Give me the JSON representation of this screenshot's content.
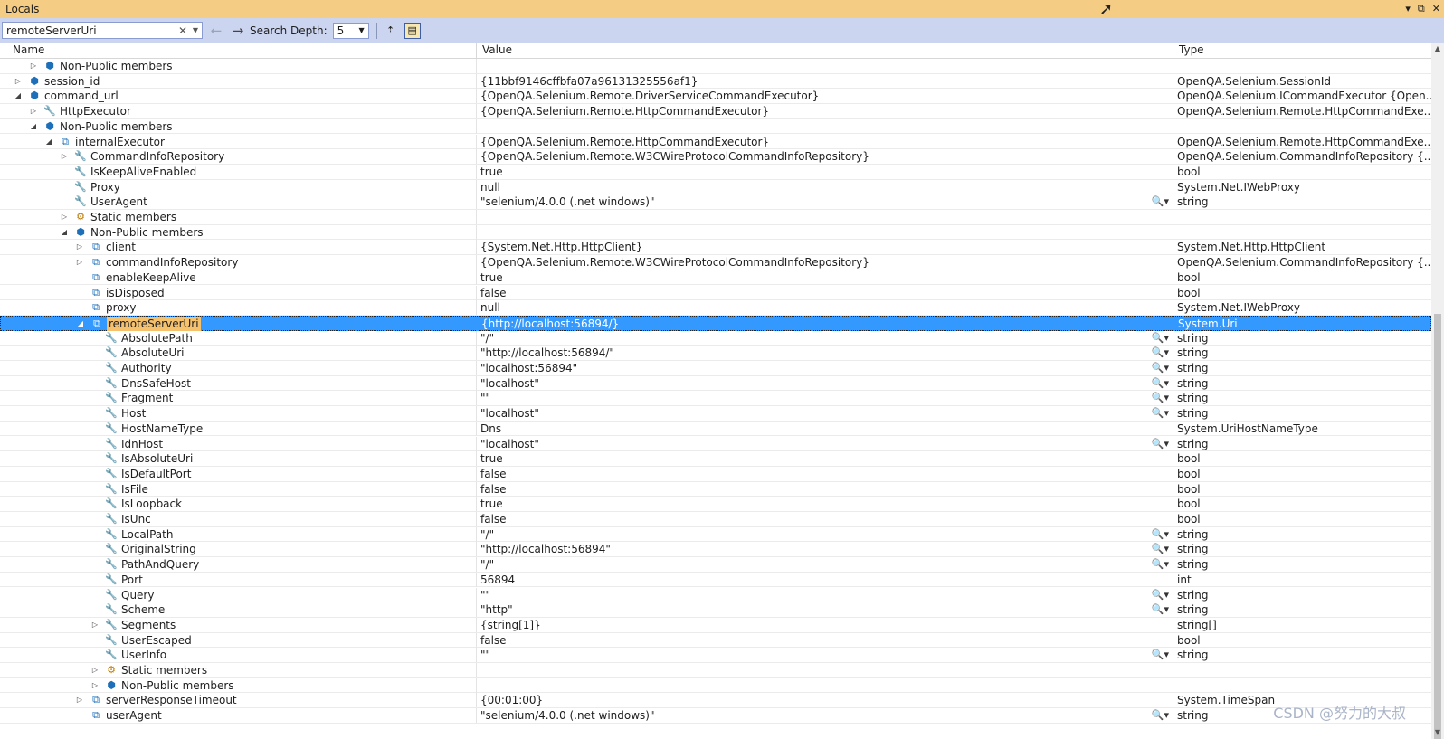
{
  "window": {
    "title": "Locals",
    "controls": [
      "▾",
      "⧉",
      "✕"
    ]
  },
  "toolbar": {
    "search_value": "remoteServerUri",
    "search_depth_label": "Search Depth:",
    "search_depth_value": "5"
  },
  "columns": {
    "name": "Name",
    "value": "Value",
    "type": "Type"
  },
  "rows": [
    {
      "name": "Non-Public members",
      "value": "",
      "type": "",
      "level": 2,
      "expander": "collapsed",
      "icon": "cube"
    },
    {
      "name": "session_id",
      "value": "{11bbf9146cffbfa07a96131325556af1}",
      "type": "OpenQA.Selenium.SessionId",
      "level": 1,
      "expander": "collapsed",
      "icon": "cube"
    },
    {
      "name": "command_url",
      "value": "{OpenQA.Selenium.Remote.DriverServiceCommandExecutor}",
      "type": "OpenQA.Selenium.ICommandExecutor {Open...",
      "level": 1,
      "expander": "expanded",
      "icon": "cube"
    },
    {
      "name": "HttpExecutor",
      "value": "{OpenQA.Selenium.Remote.HttpCommandExecutor}",
      "type": "OpenQA.Selenium.Remote.HttpCommandExe...",
      "level": 2,
      "expander": "collapsed",
      "icon": "wrench"
    },
    {
      "name": "Non-Public members",
      "value": "",
      "type": "",
      "level": 2,
      "expander": "expanded",
      "icon": "cube"
    },
    {
      "name": "internalExecutor",
      "value": "{OpenQA.Selenium.Remote.HttpCommandExecutor}",
      "type": "OpenQA.Selenium.Remote.HttpCommandExe...",
      "level": 3,
      "expander": "expanded",
      "icon": "field"
    },
    {
      "name": "CommandInfoRepository",
      "value": "{OpenQA.Selenium.Remote.W3CWireProtocolCommandInfoRepository}",
      "type": "OpenQA.Selenium.CommandInfoRepository {...",
      "level": 4,
      "expander": "collapsed",
      "icon": "wrench"
    },
    {
      "name": "IsKeepAliveEnabled",
      "value": "true",
      "type": "bool",
      "level": 4,
      "expander": "none",
      "icon": "wrench"
    },
    {
      "name": "Proxy",
      "value": "null",
      "type": "System.Net.IWebProxy",
      "level": 4,
      "expander": "none",
      "icon": "wrench"
    },
    {
      "name": "UserAgent",
      "value": "\"selenium/4.0.0 (.net windows)\"",
      "type": "string",
      "level": 4,
      "expander": "none",
      "icon": "wrench",
      "mag": true
    },
    {
      "name": "Static members",
      "value": "",
      "type": "",
      "level": 4,
      "expander": "collapsed",
      "icon": "static"
    },
    {
      "name": "Non-Public members",
      "value": "",
      "type": "",
      "level": 4,
      "expander": "expanded",
      "icon": "cube"
    },
    {
      "name": "client",
      "value": "{System.Net.Http.HttpClient}",
      "type": "System.Net.Http.HttpClient",
      "level": 5,
      "expander": "collapsed",
      "icon": "field"
    },
    {
      "name": "commandInfoRepository",
      "value": "{OpenQA.Selenium.Remote.W3CWireProtocolCommandInfoRepository}",
      "type": "OpenQA.Selenium.CommandInfoRepository {...",
      "level": 5,
      "expander": "collapsed",
      "icon": "field"
    },
    {
      "name": "enableKeepAlive",
      "value": "true",
      "type": "bool",
      "level": 5,
      "expander": "none",
      "icon": "field"
    },
    {
      "name": "isDisposed",
      "value": "false",
      "type": "bool",
      "level": 5,
      "expander": "none",
      "icon": "field"
    },
    {
      "name": "proxy",
      "value": "null",
      "type": "System.Net.IWebProxy",
      "level": 5,
      "expander": "none",
      "icon": "field"
    },
    {
      "name": "remoteServerUri",
      "value": "{http://localhost:56894/}",
      "type": "System.Uri",
      "level": 5,
      "expander": "expanded",
      "icon": "field",
      "selected": true
    },
    {
      "name": "AbsolutePath",
      "value": "\"/\"",
      "type": "string",
      "level": 6,
      "expander": "none",
      "icon": "wrench",
      "mag": true
    },
    {
      "name": "AbsoluteUri",
      "value": "\"http://localhost:56894/\"",
      "type": "string",
      "level": 6,
      "expander": "none",
      "icon": "wrench",
      "mag": true
    },
    {
      "name": "Authority",
      "value": "\"localhost:56894\"",
      "type": "string",
      "level": 6,
      "expander": "none",
      "icon": "wrench",
      "mag": true
    },
    {
      "name": "DnsSafeHost",
      "value": "\"localhost\"",
      "type": "string",
      "level": 6,
      "expander": "none",
      "icon": "wrench",
      "mag": true
    },
    {
      "name": "Fragment",
      "value": "\"\"",
      "type": "string",
      "level": 6,
      "expander": "none",
      "icon": "wrench",
      "mag": true
    },
    {
      "name": "Host",
      "value": "\"localhost\"",
      "type": "string",
      "level": 6,
      "expander": "none",
      "icon": "wrench",
      "mag": true
    },
    {
      "name": "HostNameType",
      "value": "Dns",
      "type": "System.UriHostNameType",
      "level": 6,
      "expander": "none",
      "icon": "wrench"
    },
    {
      "name": "IdnHost",
      "value": "\"localhost\"",
      "type": "string",
      "level": 6,
      "expander": "none",
      "icon": "wrench",
      "mag": true
    },
    {
      "name": "IsAbsoluteUri",
      "value": "true",
      "type": "bool",
      "level": 6,
      "expander": "none",
      "icon": "wrench"
    },
    {
      "name": "IsDefaultPort",
      "value": "false",
      "type": "bool",
      "level": 6,
      "expander": "none",
      "icon": "wrench"
    },
    {
      "name": "IsFile",
      "value": "false",
      "type": "bool",
      "level": 6,
      "expander": "none",
      "icon": "wrench"
    },
    {
      "name": "IsLoopback",
      "value": "true",
      "type": "bool",
      "level": 6,
      "expander": "none",
      "icon": "wrench"
    },
    {
      "name": "IsUnc",
      "value": "false",
      "type": "bool",
      "level": 6,
      "expander": "none",
      "icon": "wrench"
    },
    {
      "name": "LocalPath",
      "value": "\"/\"",
      "type": "string",
      "level": 6,
      "expander": "none",
      "icon": "wrench",
      "mag": true
    },
    {
      "name": "OriginalString",
      "value": "\"http://localhost:56894\"",
      "type": "string",
      "level": 6,
      "expander": "none",
      "icon": "wrench",
      "mag": true
    },
    {
      "name": "PathAndQuery",
      "value": "\"/\"",
      "type": "string",
      "level": 6,
      "expander": "none",
      "icon": "wrench",
      "mag": true
    },
    {
      "name": "Port",
      "value": "56894",
      "type": "int",
      "level": 6,
      "expander": "none",
      "icon": "wrench"
    },
    {
      "name": "Query",
      "value": "\"\"",
      "type": "string",
      "level": 6,
      "expander": "none",
      "icon": "wrench",
      "mag": true
    },
    {
      "name": "Scheme",
      "value": "\"http\"",
      "type": "string",
      "level": 6,
      "expander": "none",
      "icon": "wrench",
      "mag": true
    },
    {
      "name": "Segments",
      "value": "{string[1]}",
      "type": "string[]",
      "level": 6,
      "expander": "collapsed",
      "icon": "wrench"
    },
    {
      "name": "UserEscaped",
      "value": "false",
      "type": "bool",
      "level": 6,
      "expander": "none",
      "icon": "wrench"
    },
    {
      "name": "UserInfo",
      "value": "\"\"",
      "type": "string",
      "level": 6,
      "expander": "none",
      "icon": "wrench",
      "mag": true
    },
    {
      "name": "Static members",
      "value": "",
      "type": "",
      "level": 6,
      "expander": "collapsed",
      "icon": "static"
    },
    {
      "name": "Non-Public members",
      "value": "",
      "type": "",
      "level": 6,
      "expander": "collapsed",
      "icon": "cube"
    },
    {
      "name": "serverResponseTimeout",
      "value": "{00:01:00}",
      "type": "System.TimeSpan",
      "level": 5,
      "expander": "collapsed",
      "icon": "field"
    },
    {
      "name": "userAgent",
      "value": "\"selenium/4.0.0 (.net windows)\"",
      "type": "string",
      "level": 5,
      "expander": "none",
      "icon": "field",
      "mag": true
    }
  ],
  "watermark": "CSDN @努力的大叔",
  "colors": {
    "title_bg": "#f5cc84",
    "toolbar_bg": "#ccd5f0",
    "selection": "#3399ff",
    "highlight": "#f5c16c"
  }
}
